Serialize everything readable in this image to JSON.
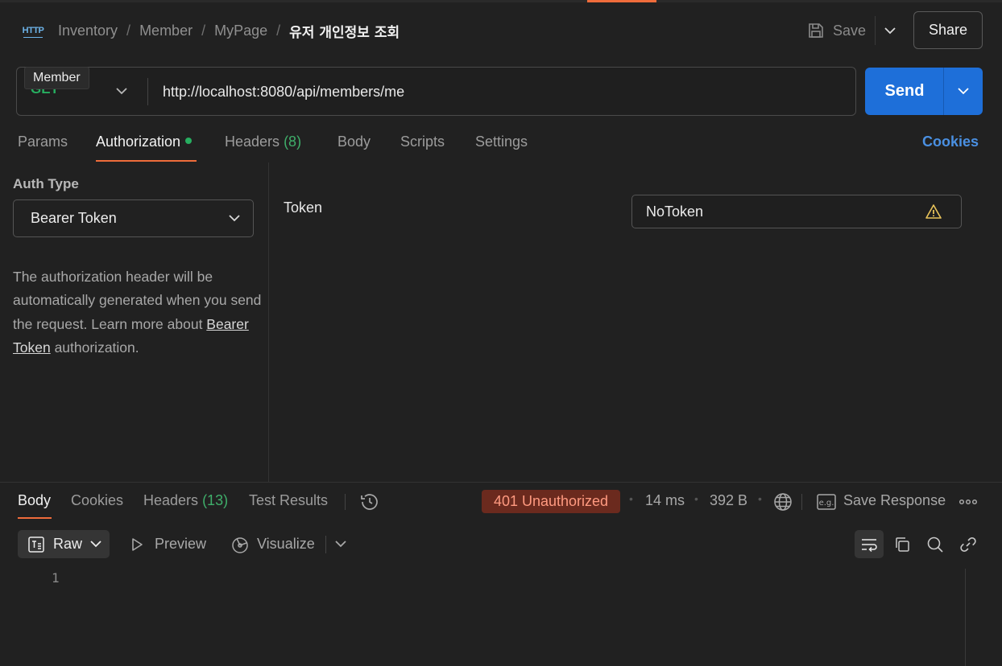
{
  "header": {
    "icon": "http-icon",
    "icon_text": "HTTP",
    "breadcrumbs": [
      "Inventory",
      "Member",
      "MyPage"
    ],
    "current": "유저 개인정보 조회",
    "separator": "/",
    "save_label": "Save",
    "share_label": "Share"
  },
  "request": {
    "method": "GET",
    "url": "http://localhost:8080/api/members/me",
    "tooltip": "Member",
    "send_label": "Send"
  },
  "tabs": {
    "params": "Params",
    "authorization": "Authorization",
    "headers": "Headers",
    "headers_count": "(8)",
    "body": "Body",
    "scripts": "Scripts",
    "settings": "Settings",
    "cookies": "Cookies"
  },
  "auth": {
    "type_label": "Auth Type",
    "type_value": "Bearer Token",
    "desc_prefix": "The authorization header will be automatically generated when you send the request. Learn more about ",
    "desc_link": "Bearer Token",
    "desc_suffix": " authorization.",
    "token_label": "Token",
    "token_value": "NoToken"
  },
  "response": {
    "tabs": {
      "body": "Body",
      "cookies": "Cookies",
      "headers": "Headers",
      "headers_count": "(13)",
      "test_results": "Test Results"
    },
    "status": "401 Unauthorized",
    "time": "14 ms",
    "size": "392 B",
    "save_response": "Save Response",
    "format": "Raw",
    "preview": "Preview",
    "visualize": "Visualize",
    "line_numbers": [
      "1"
    ]
  },
  "colors": {
    "accent": "#ef6c3b",
    "send": "#1e6fd9",
    "method_get": "#27ae60",
    "status_bg": "#6b2a1e",
    "status_text": "#ff9a80",
    "link": "#4a90e2"
  }
}
